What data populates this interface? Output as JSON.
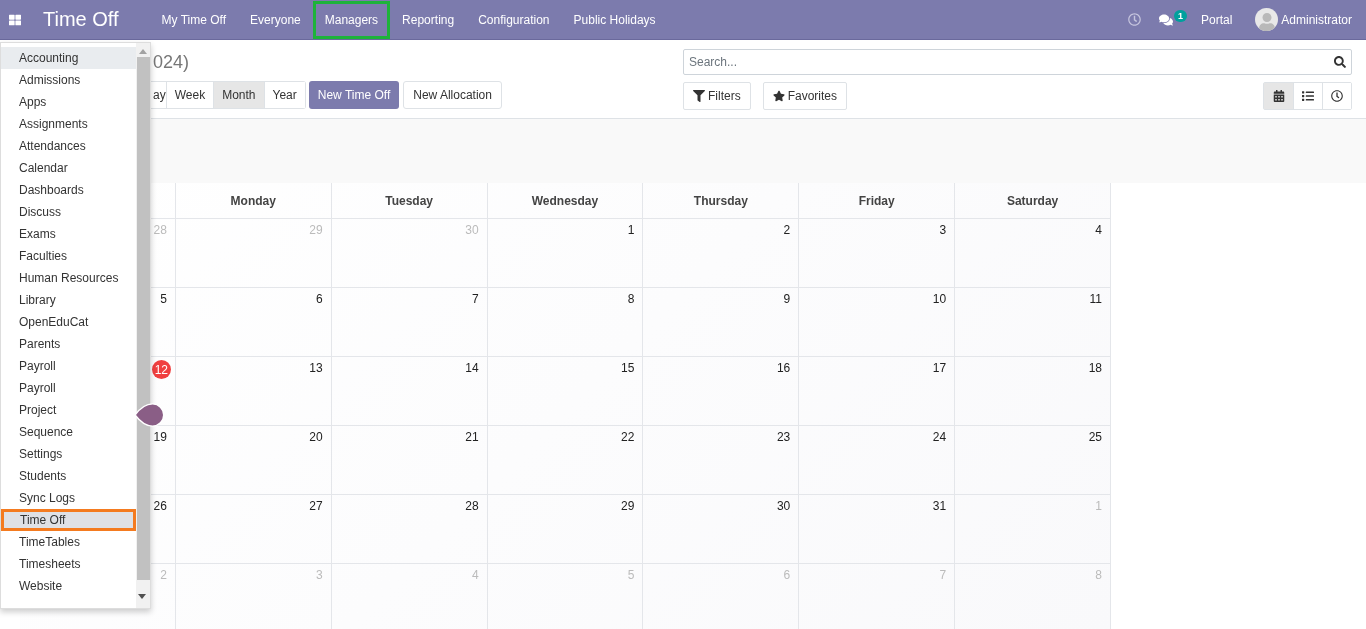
{
  "header": {
    "app_title": "Time Off",
    "nav": [
      {
        "label": "My Time Off",
        "highlighted": false
      },
      {
        "label": "Everyone",
        "highlighted": false
      },
      {
        "label": "Managers",
        "highlighted": true
      },
      {
        "label": "Reporting",
        "highlighted": false
      },
      {
        "label": "Configuration",
        "highlighted": false
      },
      {
        "label": "Public Holidays",
        "highlighted": false
      }
    ],
    "chat_badge": "1",
    "portal": "Portal",
    "user": "Administrator"
  },
  "control_panel": {
    "title_fragment": "024)",
    "scale_buttons": [
      {
        "label": "ay",
        "selected": false
      },
      {
        "label": "Week",
        "selected": false
      },
      {
        "label": "Month",
        "selected": true
      },
      {
        "label": "Year",
        "selected": false
      }
    ],
    "primary_button": "New Time Off",
    "secondary_button": "New Allocation",
    "search": {
      "placeholder": "Search..."
    },
    "filters": "Filters",
    "favorites": "Favorites",
    "views": [
      {
        "kind": "calendar",
        "selected": true
      },
      {
        "kind": "list",
        "selected": false
      },
      {
        "kind": "activity",
        "selected": false
      }
    ]
  },
  "calendar": {
    "weekdays": [
      "Monday",
      "Tuesday",
      "Wednesday",
      "Thursday",
      "Friday",
      "Saturday"
    ],
    "weeks": [
      [
        {
          "day": "28",
          "muted": true,
          "today": false
        },
        {
          "day": "29",
          "muted": true,
          "today": false
        },
        {
          "day": "30",
          "muted": true,
          "today": false
        },
        {
          "day": "1",
          "muted": false,
          "today": false
        },
        {
          "day": "2",
          "muted": false,
          "today": false
        },
        {
          "day": "3",
          "muted": false,
          "today": false
        },
        {
          "day": "4",
          "muted": false,
          "today": false
        }
      ],
      [
        {
          "day": "5",
          "muted": false,
          "today": false
        },
        {
          "day": "6",
          "muted": false,
          "today": false
        },
        {
          "day": "7",
          "muted": false,
          "today": false
        },
        {
          "day": "8",
          "muted": false,
          "today": false
        },
        {
          "day": "9",
          "muted": false,
          "today": false
        },
        {
          "day": "10",
          "muted": false,
          "today": false
        },
        {
          "day": "11",
          "muted": false,
          "today": false
        }
      ],
      [
        {
          "day": "12",
          "muted": false,
          "today": true
        },
        {
          "day": "13",
          "muted": false,
          "today": false
        },
        {
          "day": "14",
          "muted": false,
          "today": false
        },
        {
          "day": "15",
          "muted": false,
          "today": false
        },
        {
          "day": "16",
          "muted": false,
          "today": false
        },
        {
          "day": "17",
          "muted": false,
          "today": false
        },
        {
          "day": "18",
          "muted": false,
          "today": false
        }
      ],
      [
        {
          "day": "19",
          "muted": false,
          "today": false
        },
        {
          "day": "20",
          "muted": false,
          "today": false
        },
        {
          "day": "21",
          "muted": false,
          "today": false
        },
        {
          "day": "22",
          "muted": false,
          "today": false
        },
        {
          "day": "23",
          "muted": false,
          "today": false
        },
        {
          "day": "24",
          "muted": false,
          "today": false
        },
        {
          "day": "25",
          "muted": false,
          "today": false
        }
      ],
      [
        {
          "day": "26",
          "muted": false,
          "today": false
        },
        {
          "day": "27",
          "muted": false,
          "today": false
        },
        {
          "day": "28",
          "muted": false,
          "today": false
        },
        {
          "day": "29",
          "muted": false,
          "today": false
        },
        {
          "day": "30",
          "muted": false,
          "today": false
        },
        {
          "day": "31",
          "muted": false,
          "today": false
        },
        {
          "day": "1",
          "muted": true,
          "today": false
        }
      ],
      [
        {
          "day": "2",
          "muted": true,
          "today": false
        },
        {
          "day": "3",
          "muted": true,
          "today": false
        },
        {
          "day": "4",
          "muted": true,
          "today": false
        },
        {
          "day": "5",
          "muted": true,
          "today": false
        },
        {
          "day": "6",
          "muted": true,
          "today": false
        },
        {
          "day": "7",
          "muted": true,
          "today": false
        },
        {
          "day": "8",
          "muted": true,
          "today": false
        }
      ]
    ]
  },
  "app_menu": {
    "items": [
      {
        "label": "Accounting",
        "active": true,
        "highlighted": false
      },
      {
        "label": "Admissions",
        "active": false,
        "highlighted": false
      },
      {
        "label": "Apps",
        "active": false,
        "highlighted": false
      },
      {
        "label": "Assignments",
        "active": false,
        "highlighted": false
      },
      {
        "label": "Attendances",
        "active": false,
        "highlighted": false
      },
      {
        "label": "Calendar",
        "active": false,
        "highlighted": false
      },
      {
        "label": "Dashboards",
        "active": false,
        "highlighted": false
      },
      {
        "label": "Discuss",
        "active": false,
        "highlighted": false
      },
      {
        "label": "Exams",
        "active": false,
        "highlighted": false
      },
      {
        "label": "Faculties",
        "active": false,
        "highlighted": false
      },
      {
        "label": "Human Resources",
        "active": false,
        "highlighted": false
      },
      {
        "label": "Library",
        "active": false,
        "highlighted": false
      },
      {
        "label": "OpenEduCat",
        "active": false,
        "highlighted": false
      },
      {
        "label": "Parents",
        "active": false,
        "highlighted": false
      },
      {
        "label": "Payroll",
        "active": false,
        "highlighted": false
      },
      {
        "label": "Payroll",
        "active": false,
        "highlighted": false
      },
      {
        "label": "Project",
        "active": false,
        "highlighted": false
      },
      {
        "label": "Sequence",
        "active": false,
        "highlighted": false
      },
      {
        "label": "Settings",
        "active": false,
        "highlighted": false
      },
      {
        "label": "Students",
        "active": false,
        "highlighted": false
      },
      {
        "label": "Sync Logs",
        "active": false,
        "highlighted": false
      },
      {
        "label": "Time Off",
        "active": false,
        "highlighted": true
      },
      {
        "label": "TimeTables",
        "active": false,
        "highlighted": false
      },
      {
        "label": "Timesheets",
        "active": false,
        "highlighted": false
      },
      {
        "label": "Website",
        "active": false,
        "highlighted": false
      }
    ]
  }
}
